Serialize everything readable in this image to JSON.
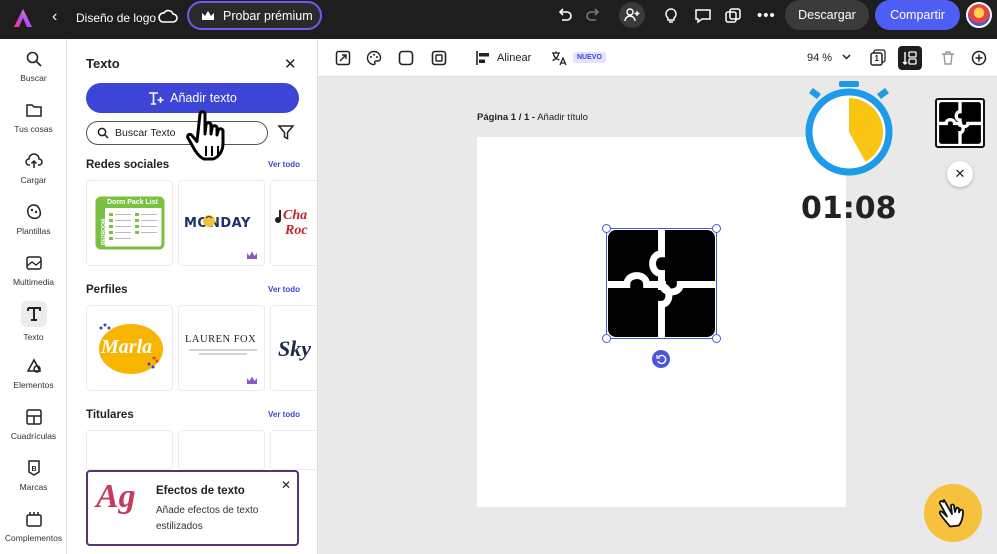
{
  "topbar": {
    "doc_title": "Diseño de logo",
    "premium_label": "Probar prémium",
    "download_label": "Descargar",
    "share_label": "Compartir",
    "more_label": "•••",
    "icons": [
      "adobe-express-logo",
      "back-icon",
      "cloud-icon",
      "crown-icon",
      "undo-icon",
      "redo-icon",
      "invite-icon",
      "bulb-icon",
      "comment-icon",
      "present-icon",
      "more-icon",
      "avatar"
    ]
  },
  "leftnav": {
    "items": [
      {
        "label": "Buscar",
        "icon": "search-icon"
      },
      {
        "label": "Tus cosas",
        "icon": "folder-icon"
      },
      {
        "label": "Cargar",
        "icon": "upload-icon"
      },
      {
        "label": "Plantillas",
        "icon": "templates-icon"
      },
      {
        "label": "Multimedia",
        "icon": "media-icon"
      },
      {
        "label": "Texto",
        "icon": "text-icon"
      },
      {
        "label": "Elementos",
        "icon": "elements-icon"
      },
      {
        "label": "Cuadrículas",
        "icon": "grid-icon"
      },
      {
        "label": "Marcas",
        "icon": "brand-icon"
      },
      {
        "label": "Complementos",
        "icon": "addons-icon"
      }
    ],
    "active": "Texto"
  },
  "panel": {
    "title": "Texto",
    "add_text_label": "Añadir texto",
    "search_placeholder": "Buscar Texto",
    "sections": [
      {
        "title": "Redes sociales",
        "see_all": "Ver todo"
      },
      {
        "title": "Perfiles",
        "see_all": "Ver todo"
      },
      {
        "title": "Titulares",
        "see_all": "Ver todo"
      }
    ],
    "social_thumbs": {
      "dorm_title": "Dorm Pack List",
      "dorm_side": "BEDROOM",
      "monday": "MONDAY",
      "cha": "Cha",
      "roc": "Roc"
    },
    "profile_thumbs": {
      "marla": "Marla",
      "lauren": "LAUREN FOX",
      "sky": "Sky"
    },
    "effects": {
      "glyph": "Ag",
      "title": "Efectos de texto",
      "desc": "Añade efectos de texto estilizados"
    }
  },
  "canvas_toolbar": {
    "align_label": "Alinear",
    "new_badge": "NUEVO",
    "zoom": "94 %",
    "layers_count": "1"
  },
  "canvas": {
    "page_label": "Página 1 / 1 -",
    "page_title_placeholder": "Añadir título"
  },
  "overlay": {
    "timer": "01:08",
    "timer_progress": 0.42
  },
  "colors": {
    "accent": "#3d45d6",
    "share": "#4d5ef5",
    "timer_blue": "#1e9be8",
    "timer_yellow": "#f8c512",
    "effects_border": "#55356e"
  }
}
